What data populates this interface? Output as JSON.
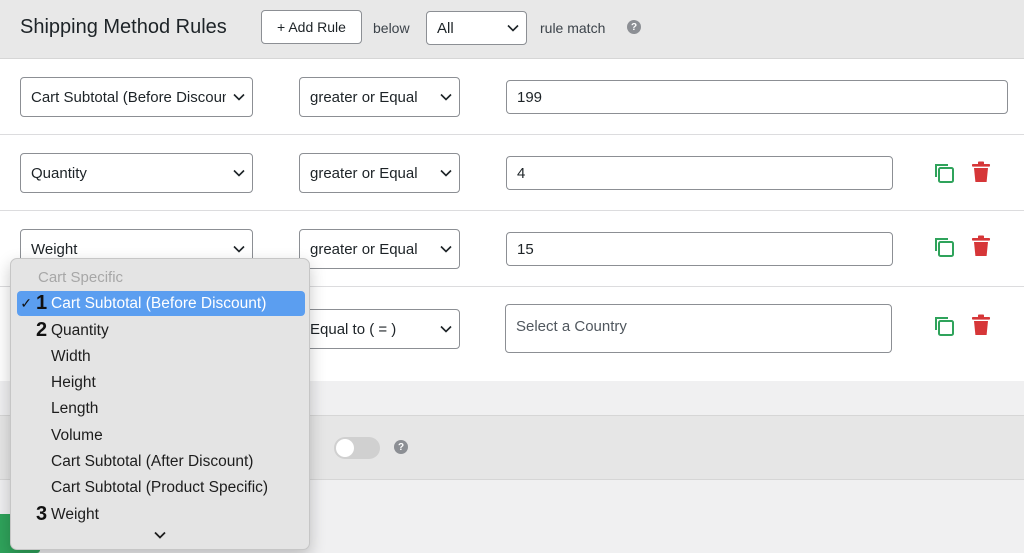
{
  "header": {
    "title": "Shipping Method Rules",
    "add_rule_label": "+ Add Rule",
    "below_label": "below",
    "match_select_value": "All",
    "rule_match_label": "rule match",
    "help_glyph": "?"
  },
  "rules": [
    {
      "field": "Cart Subtotal (Before Discount)",
      "operator": "greater or Equal",
      "value": "199",
      "placeholder": ""
    },
    {
      "field": "Quantity",
      "operator": "greater or Equal",
      "value": "4",
      "placeholder": ""
    },
    {
      "field": "Weight",
      "operator": "greater or Equal",
      "value": "15",
      "placeholder": ""
    },
    {
      "field": "",
      "operator": "Equal to ( = )",
      "value": "",
      "placeholder": "Select a Country"
    }
  ],
  "dropdown": {
    "group_label": "Cart Specific",
    "checkmark": "✓",
    "items": [
      {
        "label": "Cart Subtotal (Before Discount)",
        "marker": "1",
        "selected": true
      },
      {
        "label": "Quantity",
        "marker": "2",
        "selected": false
      },
      {
        "label": "Width",
        "marker": "",
        "selected": false
      },
      {
        "label": "Height",
        "marker": "",
        "selected": false
      },
      {
        "label": "Length",
        "marker": "",
        "selected": false
      },
      {
        "label": "Volume",
        "marker": "",
        "selected": false
      },
      {
        "label": "Cart Subtotal (After Discount)",
        "marker": "",
        "selected": false
      },
      {
        "label": "Cart Subtotal (Product Specific)",
        "marker": "",
        "selected": false
      },
      {
        "label": "Weight",
        "marker": "3",
        "selected": false
      }
    ]
  },
  "section2": {
    "help_glyph": "?",
    "toggle_on": false
  },
  "colors": {
    "copy_icon": "#2fa35b",
    "trash_icon": "#d63638",
    "highlight": "#5b9ef0",
    "green_button": "#2fa35b"
  },
  "icons": {
    "copy": "copy-icon",
    "trash": "trash-icon",
    "chevron": "chevron-down-icon",
    "help": "help-icon"
  }
}
